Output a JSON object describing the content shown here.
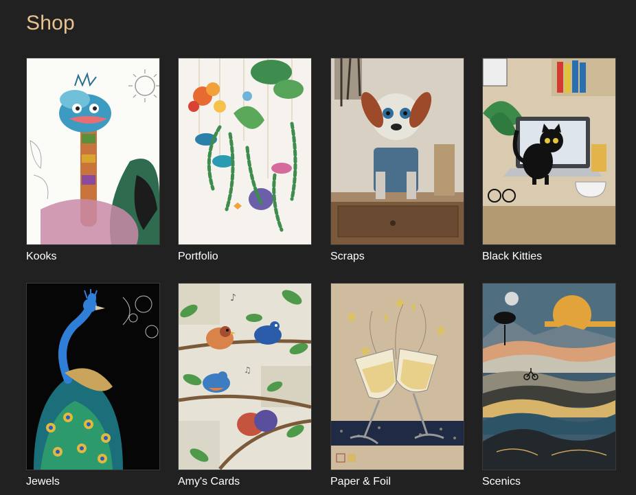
{
  "page": {
    "title": "Shop"
  },
  "categories": [
    {
      "label": "Kooks",
      "icon": "ostrich-artwork"
    },
    {
      "label": "Portfolio",
      "icon": "hanging-plants-artwork"
    },
    {
      "label": "Scraps",
      "icon": "scrap-dog-artwork"
    },
    {
      "label": "Black Kitties",
      "icon": "black-cat-desk-artwork"
    },
    {
      "label": "Jewels",
      "icon": "peacock-artwork"
    },
    {
      "label": "Amy's Cards",
      "icon": "birds-branches-artwork"
    },
    {
      "label": "Paper & Foil",
      "icon": "champagne-glasses-artwork"
    },
    {
      "label": "Scenics",
      "icon": "mountain-landscape-artwork"
    }
  ],
  "colors": {
    "background": "#212121",
    "title": "#e9c38f",
    "label": "#ffffff"
  }
}
